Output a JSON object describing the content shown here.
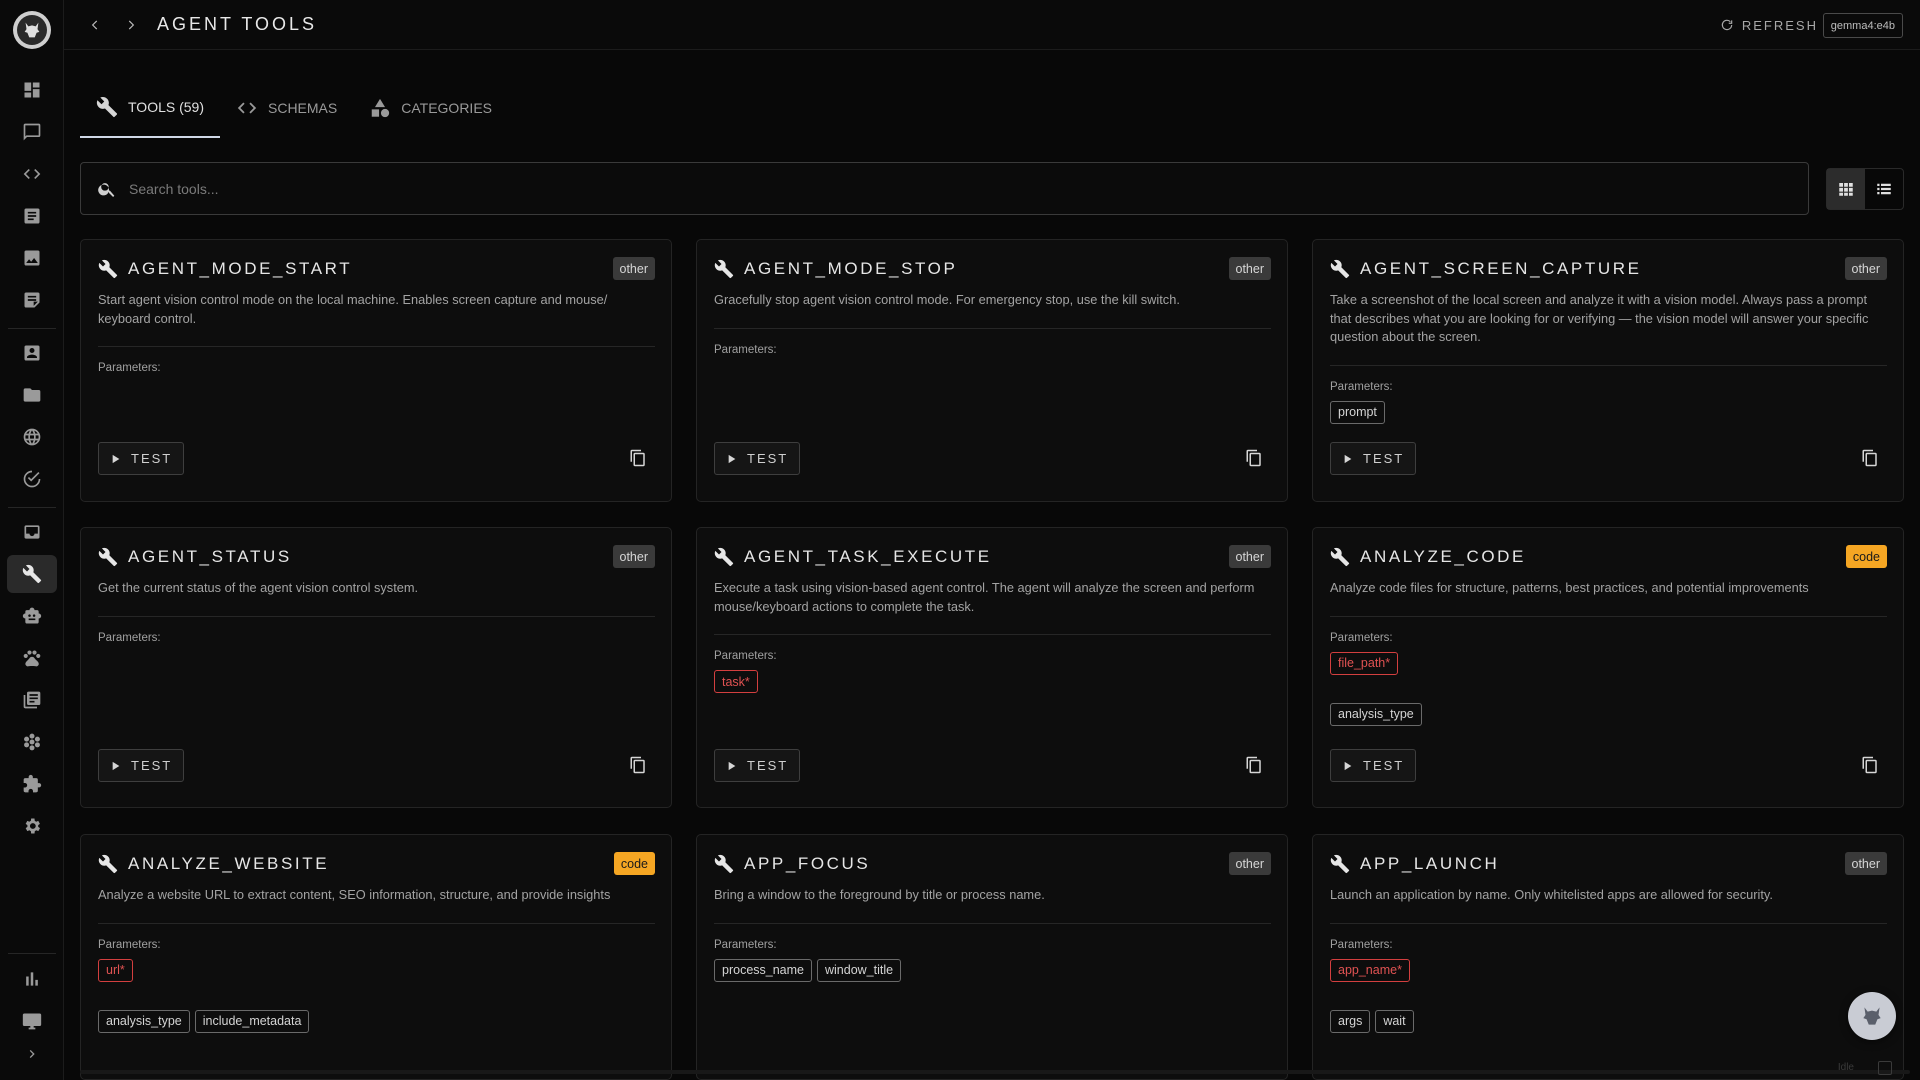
{
  "topbar": {
    "title": "AGENT TOOLS",
    "refresh_label": "REFRESH",
    "model_badge": "gemma4:e4b"
  },
  "tabs": [
    {
      "label": "TOOLS (59)",
      "icon": "wrench-icon",
      "active": true
    },
    {
      "label": "SCHEMAS",
      "icon": "code-icon",
      "active": false
    },
    {
      "label": "CATEGORIES",
      "icon": "shapes-icon",
      "active": false
    }
  ],
  "search": {
    "placeholder": "Search tools..."
  },
  "sidebar": {
    "items": [
      "dashboard-icon",
      "chat-icon",
      "code-icon",
      "document-icon",
      "image-icon",
      "notes-icon",
      "contacts-icon",
      "folder-icon",
      "globe-icon",
      "check-circle-icon",
      "inbox-icon",
      "wrench-icon",
      "robot-icon",
      "paw-icon",
      "library-icon",
      "flower-icon",
      "puzzle-icon",
      "gear-icon",
      "bar-chart-icon",
      "monitor-icon",
      "chevron-right-icon"
    ],
    "active": "wrench-icon"
  },
  "labels": {
    "parameters": "Parameters:",
    "test": "TEST"
  },
  "cards": [
    {
      "title": "AGENT_MODE_START",
      "category": "other",
      "description": "Start agent vision control mode on the local machine. Enables screen capture and mouse/ keyboard control.",
      "params": []
    },
    {
      "title": "AGENT_MODE_STOP",
      "category": "other",
      "description": "Gracefully stop agent vision control mode. For emergency stop, use the kill switch.",
      "params": []
    },
    {
      "title": "AGENT_SCREEN_CAPTURE",
      "category": "other",
      "description": "Take a screenshot of the local screen and analyze it with a vision model. Always pass a prompt that describes what you are looking for or verifying — the vision model will answer your specific question about the screen.",
      "params": [
        {
          "name": "prompt",
          "required": false
        }
      ]
    },
    {
      "title": "AGENT_STATUS",
      "category": "other",
      "description": "Get the current status of the agent vision control system.",
      "params": []
    },
    {
      "title": "AGENT_TASK_EXECUTE",
      "category": "other",
      "description": "Execute a task using vision-based agent control. The agent will analyze the screen and perform mouse/keyboard actions to complete the task.",
      "params": [
        {
          "name": "task*",
          "required": true
        }
      ]
    },
    {
      "title": "ANALYZE_CODE",
      "category": "code",
      "description": "Analyze code files for structure, patterns, best practices, and potential improvements",
      "params": [
        {
          "name": "file_path*",
          "required": true
        },
        {
          "name": "analysis_type",
          "required": false
        }
      ]
    },
    {
      "title": "ANALYZE_WEBSITE",
      "category": "code",
      "description": "Analyze a website URL to extract content, SEO information, structure, and provide insights",
      "params": [
        {
          "name": "url*",
          "required": true
        },
        {
          "name": "analysis_type",
          "required": false
        },
        {
          "name": "include_metadata",
          "required": false
        }
      ]
    },
    {
      "title": "APP_FOCUS",
      "category": "other",
      "description": "Bring a window to the foreground by title or process name.",
      "params": [
        {
          "name": "process_name",
          "required": false
        },
        {
          "name": "window_title",
          "required": false
        }
      ]
    },
    {
      "title": "APP_LAUNCH",
      "category": "other",
      "description": "Launch an application by name. Only whitelisted apps are allowed for security.",
      "params": [
        {
          "name": "app_name*",
          "required": true
        },
        {
          "name": "args",
          "required": false
        },
        {
          "name": "wait",
          "required": false
        }
      ]
    }
  ],
  "status": {
    "text": "Idle"
  }
}
